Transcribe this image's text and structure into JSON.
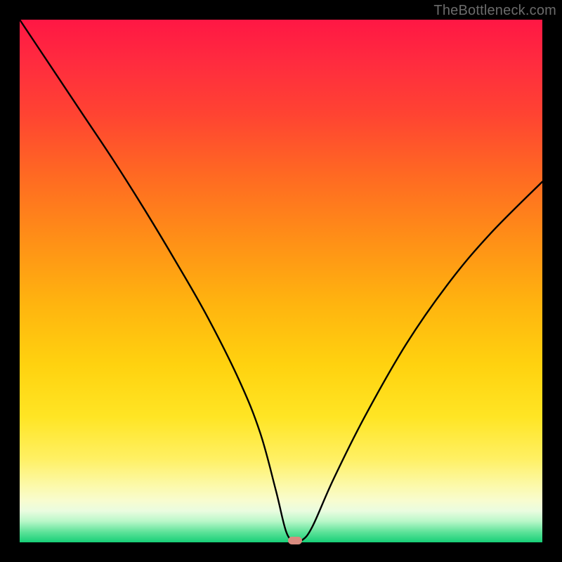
{
  "watermark": "TheBottleneck.com",
  "chart_data": {
    "type": "line",
    "title": "",
    "xlabel": "",
    "ylabel": "",
    "xlim": [
      0,
      100
    ],
    "ylim": [
      0,
      100
    ],
    "grid": false,
    "series": [
      {
        "name": "bottleneck-curve",
        "x": [
          0,
          6,
          12,
          18,
          24,
          30,
          36,
          42,
          46,
          49,
          51,
          52.5,
          54,
          56,
          60,
          66,
          74,
          82,
          90,
          100
        ],
        "y": [
          100,
          91,
          82,
          73,
          63.5,
          53.5,
          43,
          31,
          21,
          10,
          2,
          0.4,
          0.4,
          3,
          12,
          24,
          38,
          49.5,
          59,
          69
        ]
      }
    ],
    "marker": {
      "x": 52.7,
      "y": 0.4
    },
    "background": "rainbow-vertical-red-to-green"
  }
}
